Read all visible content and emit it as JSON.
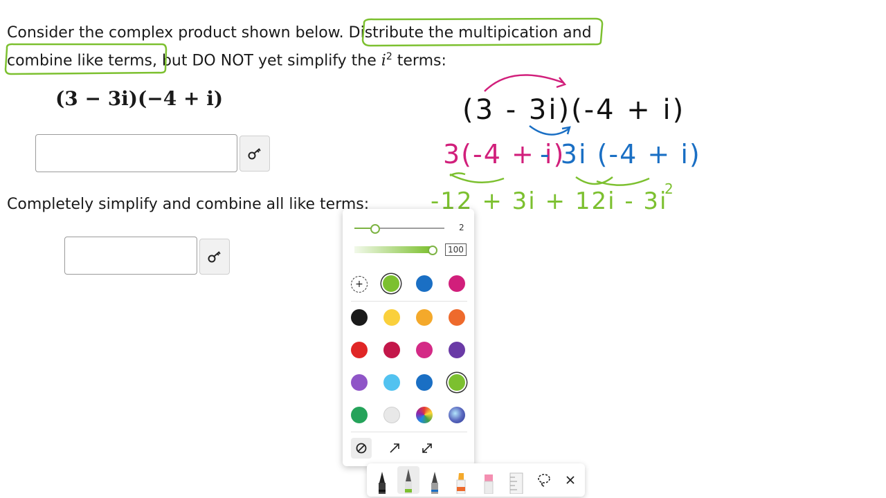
{
  "question": {
    "line1_before": "Consider the complex product shown below.",
    "line1_highlight": "Distribute the multipication",
    "line1_after": "and",
    "line2_highlight": "combine like terms",
    "line2_after": ", but DO NOT yet simplify the",
    "i_symbol": "i",
    "exponent": "2",
    "line2_end": "terms:",
    "expression": "(3 − 3i)(−4 + i)",
    "part2": "Completely simplify and combine all like terms:"
  },
  "handwriting": {
    "line1": "(3 - 3i)(-4 + i)",
    "line2_pink": "3(-4 + i)",
    "line2_blue": "- 3i (-4 + i)",
    "line3": "-12 + 3i + 12i - 3i",
    "line3_exp": "2"
  },
  "palette": {
    "thickness_value": "2",
    "opacity_value": "100",
    "add_symbol": "+",
    "colors": {
      "green": "#7cc02f",
      "blue": "#1a6fc4",
      "pink": "#d11f7b",
      "black": "#1a1a1a",
      "yellow": "#fad03c",
      "orange_yellow": "#f4a92b",
      "orange": "#ee6a2c",
      "red": "#e02626",
      "crimson": "#c3174a",
      "magenta": "#d42a86",
      "purple": "#6a3aa6",
      "violet": "#8f55c7",
      "sky": "#52c2f0",
      "royal": "#1a6fc4",
      "dark_green": "#25a35a",
      "light_gray": "#e8e8e8"
    }
  },
  "icons": [
    "key-icon",
    "no-effect-icon",
    "arrow-icon",
    "double-arrow-icon",
    "pen-icon",
    "highlighter-icon",
    "eraser-icon",
    "ruler-icon",
    "lasso-icon",
    "close-icon"
  ]
}
